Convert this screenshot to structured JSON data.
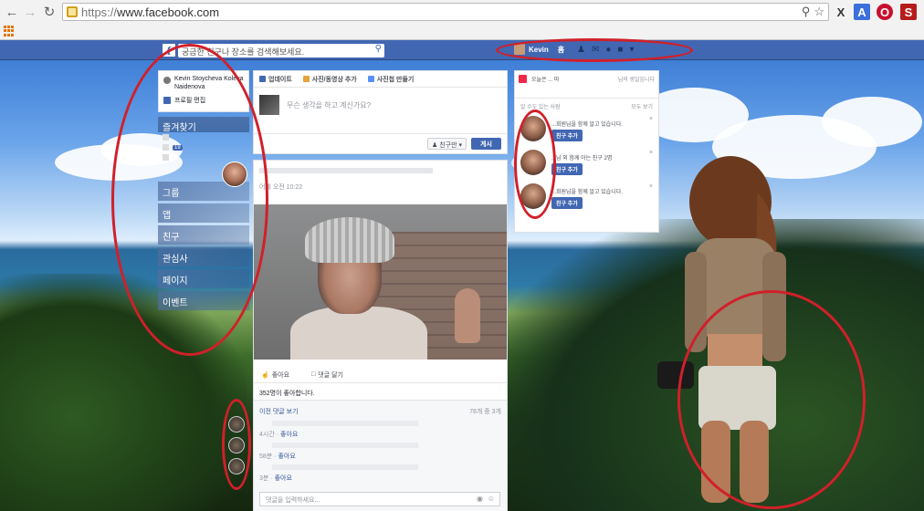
{
  "browser": {
    "scheme": "https://",
    "host": "www.facebook.com",
    "ext_icons": [
      "X",
      "A",
      "O",
      "S"
    ]
  },
  "fb": {
    "logo": "f",
    "search_placeholder": "궁금한 친구나 장소를 검색해보세요.",
    "user_name": "Kevin",
    "home_label": "홈"
  },
  "left": {
    "profile_names": "Kevin Stoycheva Koleva Naidenova",
    "edit_profile": "프로필 편집",
    "favorites": "즐겨찾기",
    "badge_count": "19",
    "groups": "그룹",
    "apps": "앱",
    "friends": "친구",
    "interests": "관심사",
    "pages": "페이지",
    "events_short": "이벤트"
  },
  "composer": {
    "tab_update": "업데이트",
    "tab_photo": "사진/동영상 추가",
    "tab_album": "사진첩 만들기",
    "placeholder": "무슨 생각을 하고 계신가요?",
    "privacy": "친구만",
    "post_button": "게시"
  },
  "post": {
    "time": "어제 오전 10:22",
    "like_action": "좋아요",
    "comment_action": "댓글 달기",
    "likes_text": "352명이 좋아합니다.",
    "more_comments": "이전 댓글 보기",
    "comment_count": "78개 중 3개",
    "comments": [
      {
        "time": "4시간",
        "like": "좋아요"
      },
      {
        "time": "58분",
        "like": "좋아요"
      },
      {
        "time": "3분",
        "like": "좋아요"
      }
    ],
    "comment_placeholder": "댓글을 입력하세요..."
  },
  "right": {
    "events_left": "오늘은 ... 마",
    "events_right": "님의 생일입니다",
    "pymk_title": "알 수도 있는 사람",
    "see_all": "모두 보기",
    "people": [
      {
        "text": "...회원님을 함께 알고 있습니다.",
        "button": "친구 추가"
      },
      {
        "text": "...님 외 함께 아는 친구 2명",
        "button": "친구 추가"
      },
      {
        "text": "...회원님을 함께 알고 있습니다.",
        "button": "친구 추가"
      }
    ]
  },
  "colors": {
    "fb_blue": "#4267b2",
    "annotation_red": "#d0202a"
  }
}
